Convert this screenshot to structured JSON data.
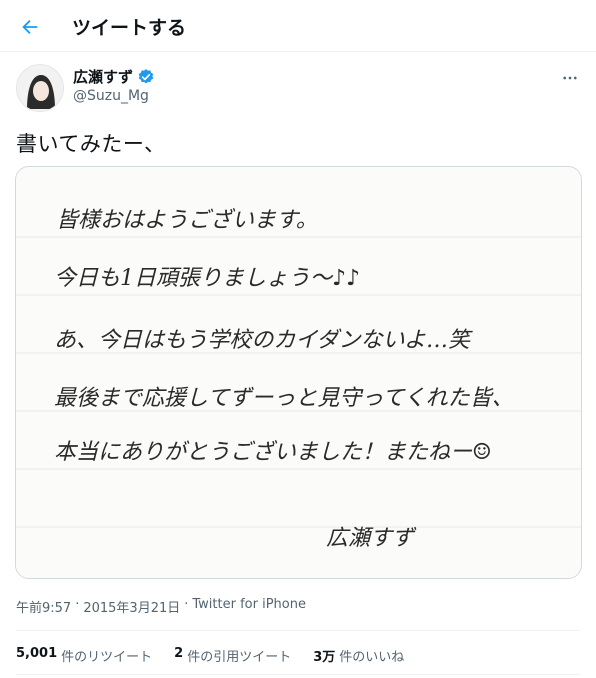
{
  "header": {
    "title": "ツイートする",
    "back_icon": "arrow-left-icon",
    "accent": "#1d9bf0"
  },
  "author": {
    "display_name": "広瀬すず",
    "handle": "@Suzu_Mg",
    "verified_icon": "verified-badge-icon",
    "verified_color": "#1d9bf0"
  },
  "tweet": {
    "text": "書いてみたー、"
  },
  "image": {
    "description_icon": "handwritten-letter-image",
    "lines": [
      "皆様おはようございます。",
      "今日も1日頑張りましょう〜♪♪",
      "あ、今日はもう学校のカイダンないよ…笑",
      "最後まで応援してずーっと見守ってくれた皆、",
      "本当にありがとうございました！またねー☺"
    ],
    "signature": "広瀬すず"
  },
  "meta": {
    "time": "午前9:57",
    "separator": "·",
    "date": "2015年3月21日",
    "source": "Twitter for iPhone"
  },
  "stats": [
    {
      "count": "5,001",
      "label": "件のリツイート"
    },
    {
      "count": "2",
      "label": "件の引用ツイート"
    },
    {
      "count": "3万",
      "label": "件のいいね"
    }
  ]
}
